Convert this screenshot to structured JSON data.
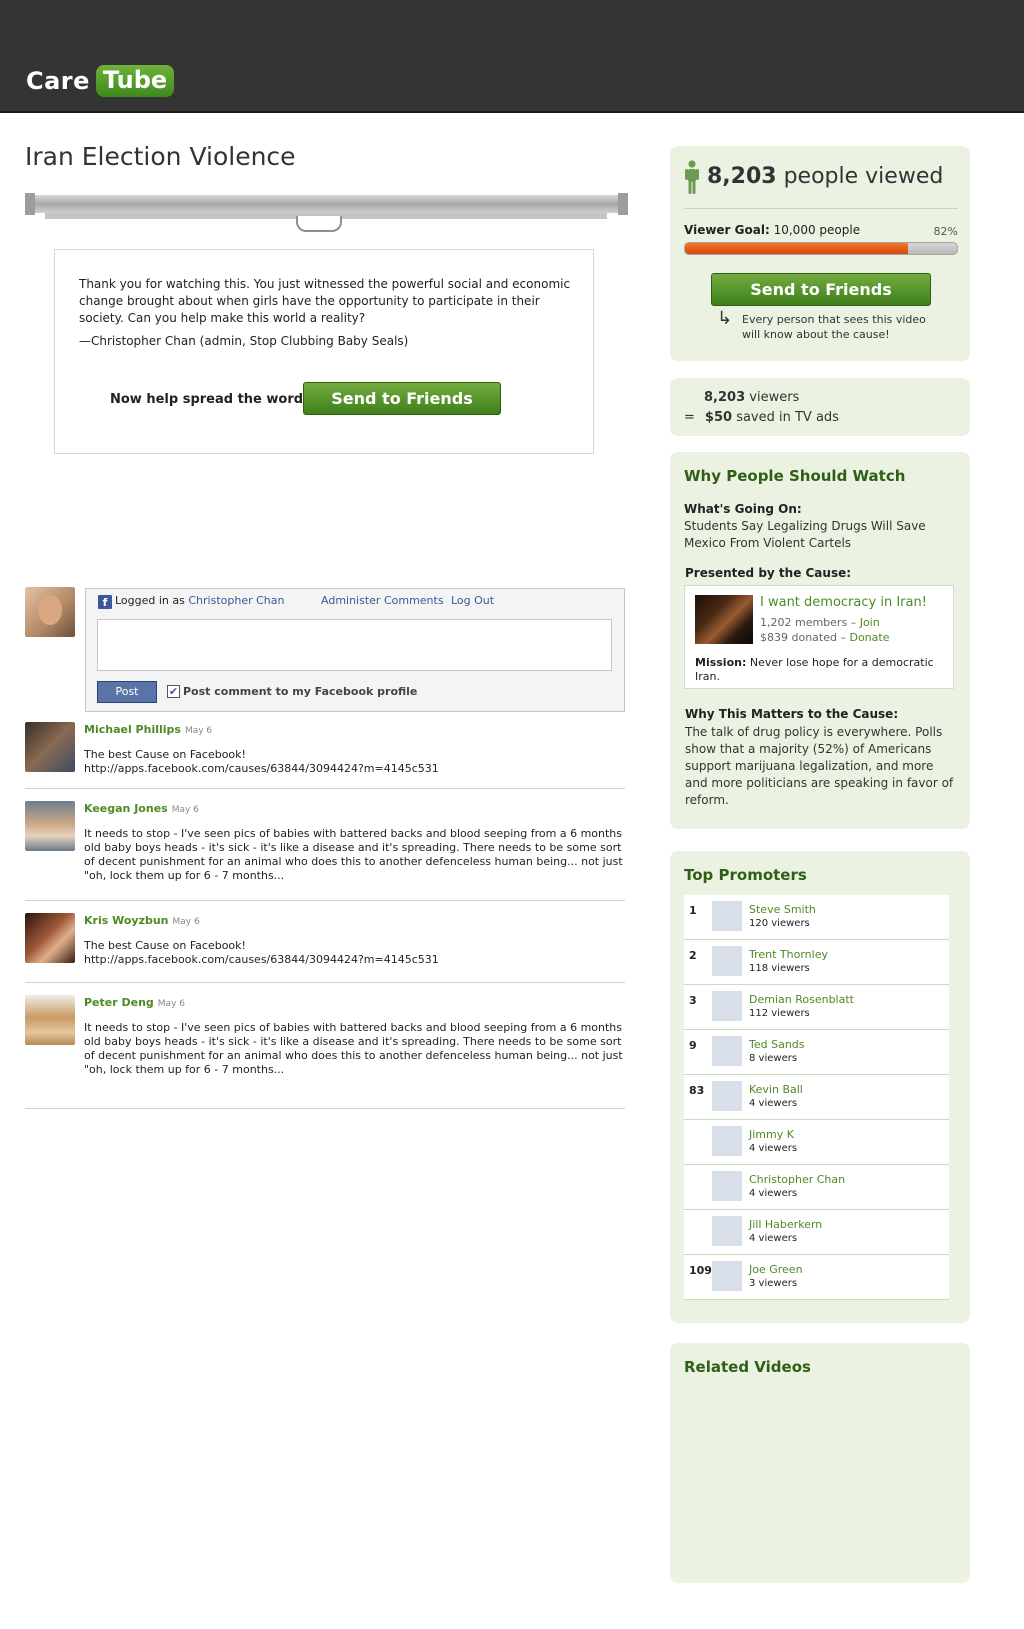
{
  "header": {
    "logo_care": "Care",
    "logo_tube": "Tube"
  },
  "video": {
    "title": "Iran Election Violence"
  },
  "thanks": {
    "message": "Thank you for watching this. You just witnessed the powerful social and economic change brought about when girls have the opportunity to participate in their society. Can you help make this world a reality?",
    "signature": "—Christopher Chan (admin, Stop Clubbing Baby Seals)",
    "spread_label": "Now help spread the word:",
    "spread_button": "Send to Friends"
  },
  "comment_form": {
    "fb_glyph": "f",
    "logged_in_prefix": "Logged in as",
    "logged_in_name": "Christopher Chan",
    "admin_link": "Administer Comments",
    "logout_link": "Log Out",
    "input_value": "",
    "post_button": "Post",
    "post_to_profile_checked": true,
    "post_to_profile_label": "Post comment to my Facebook profile"
  },
  "comments": [
    {
      "author": "Michael Phillips",
      "date": "May 6",
      "text": "The best Cause on Facebook!\nhttp://apps.facebook.com/causes/63844/3094424?m=4145c531",
      "avatar_color": "#6a5a4a"
    },
    {
      "author": "Keegan Jones",
      "date": "May 6",
      "text": "It needs to stop - I've seen pics of babies with battered backs and blood seeping from a 6 months old baby boys heads - it's sick - it's like a disease and it's spreading. There needs to be some sort of decent punishment for an animal who does this to another defenceless human being... not just \"oh, lock them up for 6 - 7 months...",
      "avatar_color": "#8b9aa8"
    },
    {
      "author": "Kris Woyzbun",
      "date": "May 6",
      "text": "The best Cause on Facebook!\nhttp://apps.facebook.com/causes/63844/3094424?m=4145c531",
      "avatar_color": "#7a3a26"
    },
    {
      "author": "Peter Deng",
      "date": "May 6",
      "text": "It needs to stop - I've seen pics of babies with battered backs and blood seeping from a 6 months old baby boys heads - it's sick - it's like a disease and it's spreading. There needs to be some sort of decent punishment for an animal who does this to another defenceless human being... not just \"oh, lock them up for 6 - 7 months...",
      "avatar_color": "#d9b98a"
    }
  ],
  "views": {
    "count": "8,203",
    "suffix": "people viewed",
    "goal_label": "Viewer Goal:",
    "goal_value": "10,000 people",
    "goal_percent_text": "82%",
    "goal_fraction": 0.82,
    "send_button": "Send to Friends",
    "arrow_glyph": "↳",
    "note": "Every person that sees this video will know about the cause!"
  },
  "savings": {
    "viewers_count": "8,203",
    "viewers_label": "viewers",
    "equals": "=",
    "amount": "$50",
    "amount_label": "saved in TV ads"
  },
  "why_watch": {
    "heading": "Why People Should Watch",
    "going_on_label": "What's Going On:",
    "going_on_text": "Students Say Legalizing Drugs Will Save Mexico From Violent Cartels",
    "presented_label": "Presented by the Cause:",
    "cause_name": "I want democracy in Iran!",
    "cause_members": "1,202 members",
    "cause_sep": "–",
    "join_link": "Join",
    "cause_donated": "$839 donated",
    "donate_link": "Donate",
    "mission_label": "Mission:",
    "mission_text": "Never lose hope for a democratic Iran.",
    "matters_label": "Why This Matters to the Cause:",
    "matters_text": "The talk of drug policy is everywhere. Polls show that a majority (52%) of Americans support marijuana legalization, and more and more politicians are speaking in favor of reform."
  },
  "top_promoters": {
    "heading": "Top Promoters",
    "items": [
      {
        "rank": "1",
        "name": "Steve Smith",
        "viewers": "120 viewers"
      },
      {
        "rank": "2",
        "name": "Trent Thornley",
        "viewers": "118 viewers"
      },
      {
        "rank": "3",
        "name": "Demian Rosenblatt",
        "viewers": "112 viewers"
      },
      {
        "rank": "9",
        "name": "Ted Sands",
        "viewers": "8 viewers"
      },
      {
        "rank": "83",
        "name": "Kevin Ball",
        "viewers": "4 viewers"
      },
      {
        "rank": "",
        "name": "Jimmy K",
        "viewers": "4 viewers"
      },
      {
        "rank": "",
        "name": "Christopher Chan",
        "viewers": "4 viewers"
      },
      {
        "rank": "",
        "name": "Jill Haberkern",
        "viewers": "4 viewers"
      },
      {
        "rank": "109",
        "name": "Joe Green",
        "viewers": "3 viewers"
      }
    ]
  },
  "related": {
    "heading": "Related Videos"
  },
  "colors": {
    "brand_green": "#3d8a1a",
    "header_bg": "#343434",
    "panel_bg": "#ebf2e2",
    "progress_orange": "#e0520f",
    "facebook_blue": "#3b5998"
  }
}
